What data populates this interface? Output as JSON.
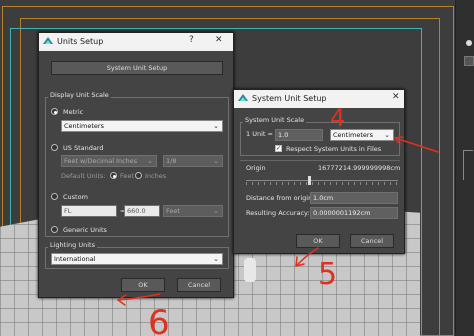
{
  "units_setup": {
    "title": "Units Setup",
    "help_symbol": "?",
    "close_symbol": "✕",
    "system_unit_setup_button": "System Unit Setup",
    "display_unit_scale_label": "Display Unit Scale",
    "metric_label": "Metric",
    "metric_value": "Centimeters",
    "us_standard_label": "US Standard",
    "us_units_value": "Feet w/Decimal Inches",
    "us_fraction_value": "1/8",
    "default_units_label": "Default Units:",
    "feet_label": "Feet",
    "inches_label": "Inches",
    "custom_label": "Custom",
    "custom_name_value": "FL",
    "custom_equals": "=",
    "custom_amount_value": "660.0",
    "custom_unit_value": "Feet",
    "generic_units_label": "Generic Units",
    "lighting_units_label": "Lighting Units",
    "lighting_value": "International",
    "ok_label": "OK",
    "cancel_label": "Cancel"
  },
  "system_unit_setup": {
    "title": "System Unit Setup",
    "close_symbol": "✕",
    "group_label": "System Unit Scale",
    "unit_prefix": "1 Unit =",
    "unit_value": "1.0",
    "unit_select": "Centimeters",
    "respect_label": "Respect System Units in Files",
    "origin_label": "Origin",
    "origin_value": "16777214.999999998cm",
    "distance_label": "Distance from origin:",
    "distance_value": "1.0cm",
    "accuracy_label": "Resulting Accuracy:",
    "accuracy_value": "0.0000001192cm",
    "ok_label": "OK",
    "cancel_label": "Cancel"
  },
  "annotations": {
    "four": "4",
    "five": "5",
    "six": "6",
    "color": "#e03020"
  }
}
